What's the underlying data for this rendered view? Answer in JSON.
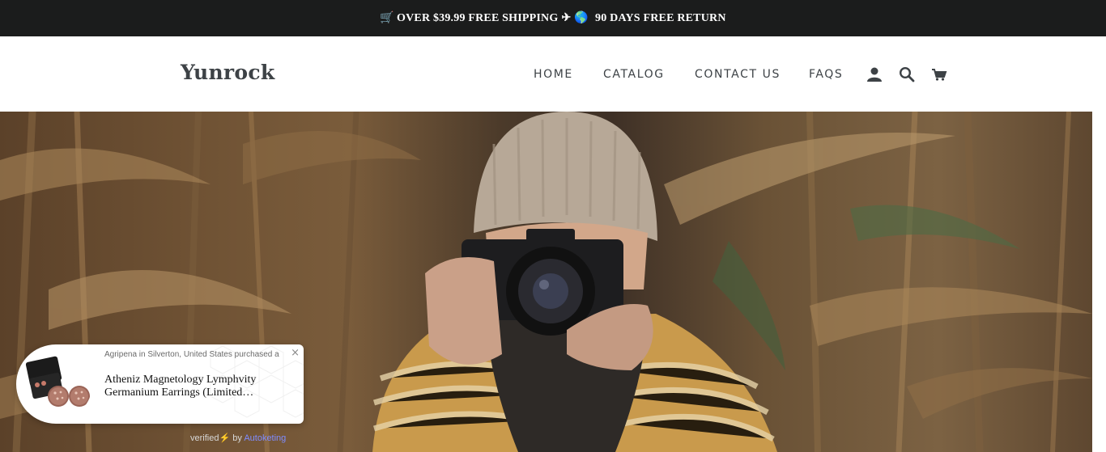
{
  "announcement": {
    "cart_icon": "🛒",
    "text_1": "OVER $39.99 FREE SHIPPING",
    "plane_icon": "✈",
    "globe_icon": "🌎",
    "text_2": "90 DAYS FREE RETURN"
  },
  "header": {
    "logo": "Yunrock",
    "nav": [
      {
        "label": "HOME"
      },
      {
        "label": "CATALOG"
      },
      {
        "label": "CONTACT US"
      },
      {
        "label": "FAQS"
      }
    ],
    "icons": [
      "account-icon",
      "search-icon",
      "cart-icon"
    ]
  },
  "hero": {
    "image": "photographer-in-cornfield"
  },
  "sales_popup": {
    "meta": "Agripena in Silverton, United States purchased a",
    "product": "Atheniz Magnetology Lymphvity Germanium Earrings  (Limited…",
    "close_icon": "×"
  },
  "verified": {
    "text": "verified",
    "bolt_icon": "⚡",
    "by": "by",
    "brand": "Autoketing"
  },
  "colors": {
    "announce_bg": "#1b1c1c",
    "text_dark": "#3d4246",
    "brand_link": "#7f8cff"
  }
}
